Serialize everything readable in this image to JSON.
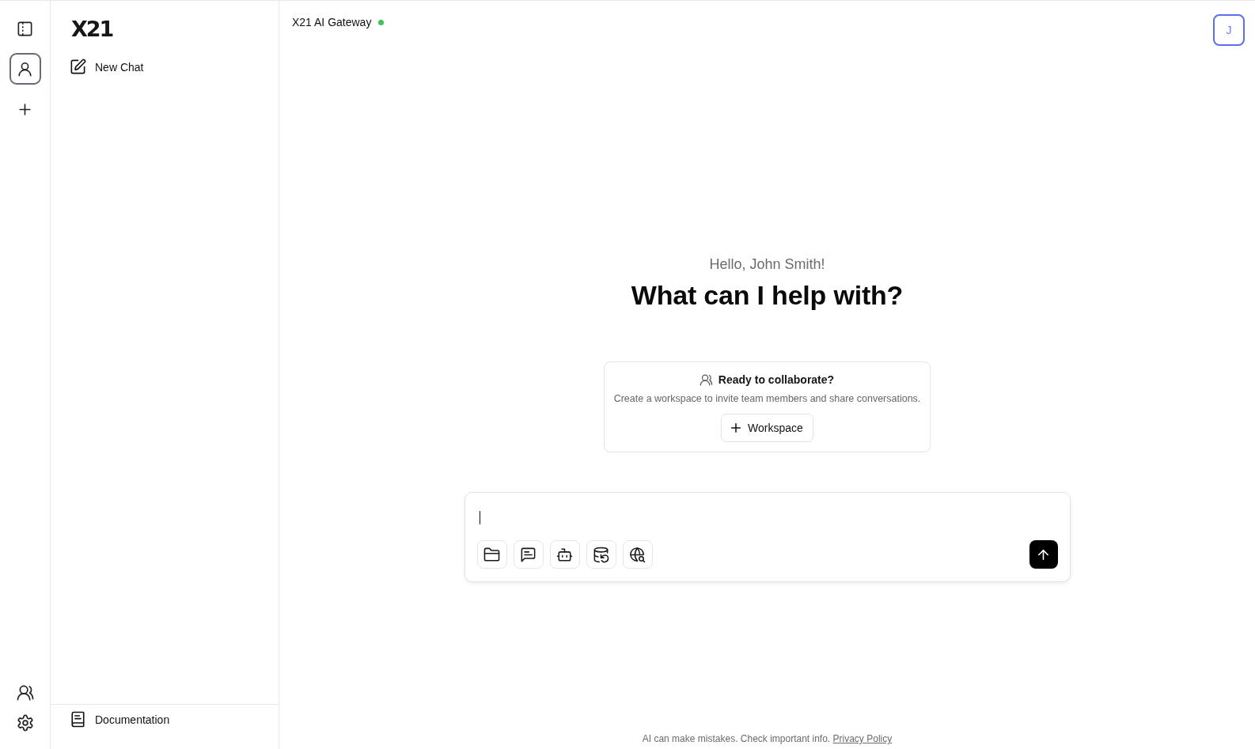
{
  "rail": {
    "top_items": [
      {
        "kind": "panel",
        "selected": false
      },
      {
        "kind": "profile",
        "selected": true
      },
      {
        "kind": "add",
        "selected": false
      }
    ],
    "bottom_items": [
      {
        "kind": "team",
        "selected": false
      },
      {
        "kind": "settings",
        "selected": false
      }
    ]
  },
  "sidebar": {
    "logo": "X21",
    "items": [
      {
        "label": "New Chat"
      }
    ],
    "footer_item": {
      "label": "Documentation"
    }
  },
  "header": {
    "title": "X21 AI Gateway",
    "connected": true,
    "avatar_initial": "J"
  },
  "welcome": {
    "greeting": "Hello, John Smith!",
    "heading": "What can I help with?"
  },
  "collaboration_card": {
    "title": "Ready to collaborate?",
    "text": "Create a workspace to invite team members and share conversations.",
    "button": "Workspace"
  },
  "composer": {
    "focused": true
  },
  "footer": {
    "text": "AI can make mistakes. Check important info.",
    "link": "Privacy Policy"
  }
}
